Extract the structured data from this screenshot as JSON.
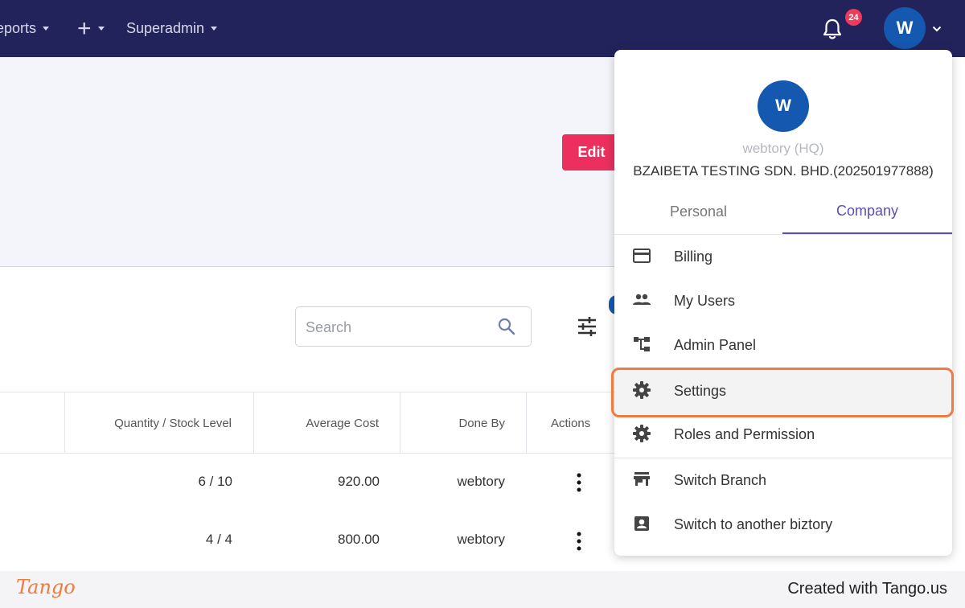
{
  "topbar": {
    "reports_label": "Reports",
    "superadmin_label": "Superadmin",
    "notification_count": "24",
    "avatar_initial": "W"
  },
  "toolbar": {
    "edit_label": "Edit",
    "search_placeholder": "Search"
  },
  "table": {
    "headers": [
      "Quantity / Stock Level",
      "Average Cost",
      "Done By",
      "Actions"
    ],
    "rows": [
      {
        "quantity": "6 / 10",
        "average_cost": "920.00",
        "done_by": "webtory"
      },
      {
        "quantity": "4 / 4",
        "average_cost": "800.00",
        "done_by": "webtory"
      }
    ]
  },
  "dropdown": {
    "avatar_initial": "W",
    "branch_name": "webtory (HQ)",
    "company_name": "BZAIBETA TESTING SDN. BHD.(202501977888)",
    "tabs": [
      {
        "label": "Personal",
        "active": false
      },
      {
        "label": "Company",
        "active": true
      }
    ],
    "items": [
      {
        "label": "Billing",
        "icon": "credit-card-icon"
      },
      {
        "label": "My Users",
        "icon": "users-icon"
      },
      {
        "label": "Admin Panel",
        "icon": "hierarchy-icon"
      },
      {
        "label": "Settings",
        "icon": "gear-icon",
        "selected": true
      },
      {
        "label": "Roles and Permission",
        "icon": "gear-icon"
      },
      {
        "label": "Switch Branch",
        "icon": "store-icon"
      },
      {
        "label": "Switch to another biztory",
        "icon": "account-box-icon"
      }
    ]
  },
  "footer": {
    "logo_text": "Tango",
    "created_text": "Created with Tango.us"
  },
  "colors": {
    "nav_bg": "#23235c",
    "accent_blue": "#1558b0",
    "edit_pink": "#ec2f5f",
    "tab_active": "#5a4fb8",
    "highlight_orange": "#f07a3f"
  }
}
